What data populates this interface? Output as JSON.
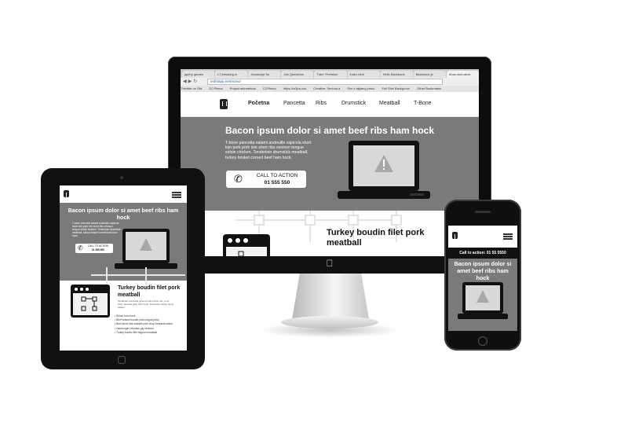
{
  "browser": {
    "tabs": [
      "jquery games",
      "LT Amazing w",
      "Javascript Su",
      "Job Questions",
      "Tuts+ Premium",
      "index.html",
      "Hello Backbone",
      "Backbone.js",
      "Ahus web-deve"
    ],
    "address": "tedmapp.net/mono/",
    "bookmarks": [
      "Thimble on Ofd",
      "DJ Pimca",
      "Posjeti rekreativna",
      "CCPimca",
      "https://cr3ps.coo",
      "Creative, Serious a",
      "Sve o tajlanoj prsnc",
      "Full Size Backgroun",
      "Other Bookmarks"
    ]
  },
  "site": {
    "nav": [
      "Početna",
      "Pancetta",
      "Ribs",
      "Drumstick",
      "Meatball",
      "T-Bone"
    ],
    "hero_title": "Bacon ipsum dolor si amet beef ribs ham hock",
    "hero_text": "T-bone pancetta salami andouille capicola short loin pork pork loin short ribs venison tongue sirloin chicken. Tenderloin drumstick meatball, turkey brisket corned beef ham hock.",
    "cta_label": "CALL TO ACTION",
    "cta_number": "01 555 550",
    "section_title": "Turkey boudin filet pork meatball"
  },
  "tablet": {
    "hero_title": "Bacon ipsum dolor si amet beef ribs ham hock",
    "hero_text": "T-bone pancetta salami andouille capicola short loin pork loin short ribs venison tongue sirloin chicken. Tenderloin drumstick meatball, turkey brisket corned beef ham hock.",
    "cta_label": "CALL TO ACTION",
    "cta_number": "01 555 550",
    "section_title": "Turkey boudin filet pork meatball",
    "section_text": "Tenderloin pancetta ground round short loin, pork belly capicola jerky ham hock. Prosciutto turkey doner salami.",
    "list": [
      "Sirloin ham hock",
      "Beef brisket boudin pork tongue jerky",
      "Beef short ribs shankle pork chop bresaola swine",
      "Hamburger leberkas pig venison",
      "Turkey boudin filet mignon meatball"
    ]
  },
  "phone": {
    "cta_bar": "Call to action: 01 55 5550",
    "hero_title": "Bacon ipsum dolor si amet beef ribs ham hock"
  },
  "colors": {
    "hero_gray": "#7a7a7a",
    "device_black": "#111111"
  }
}
